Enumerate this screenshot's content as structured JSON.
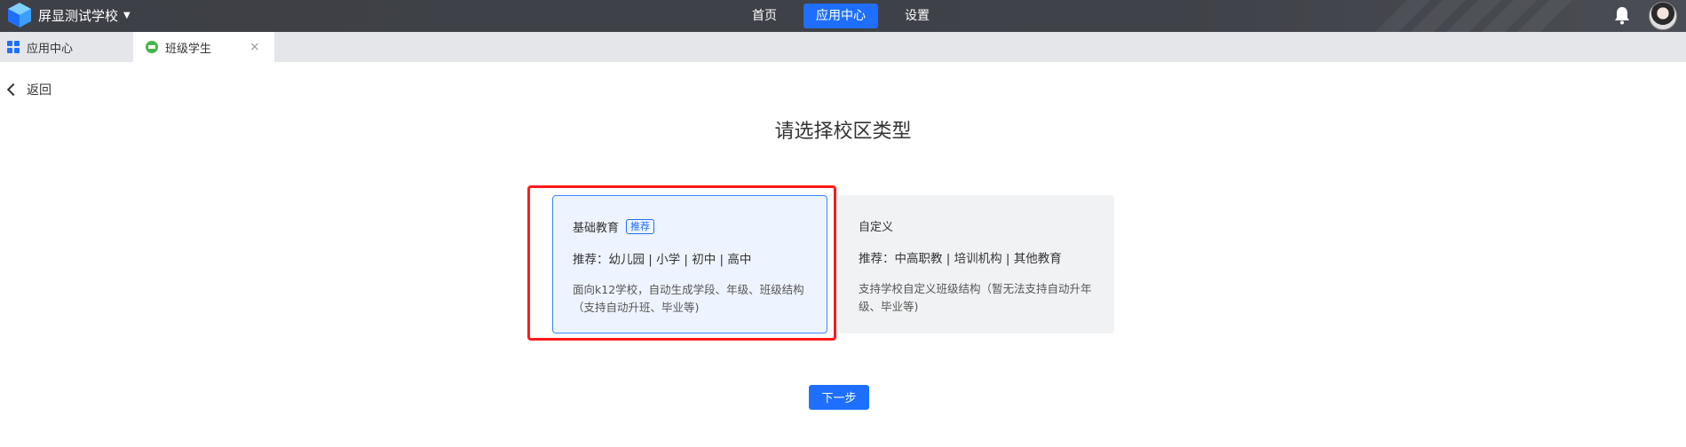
{
  "header": {
    "school_name": "屏显测试学校",
    "nav": [
      {
        "label": "首页",
        "active": false
      },
      {
        "label": "应用中心",
        "active": true
      },
      {
        "label": "设置",
        "active": false
      }
    ],
    "icons": [
      "logo-cube-icon",
      "caret-down-icon",
      "bell-icon",
      "avatar"
    ]
  },
  "tabs": [
    {
      "label": "应用中心",
      "icon": "grid-icon",
      "active": false
    },
    {
      "label": "班级学生",
      "icon": "green-class-icon",
      "active": true,
      "close": "×"
    }
  ],
  "back_label": "返回",
  "page_title": "请选择校区类型",
  "options": [
    {
      "title": "基础教育",
      "badge": "推荐",
      "recommend": "推荐：幼儿园 | 小学 | 初中 | 高中",
      "description": "面向k12学校，自动生成学段、年级、班级结构（支持自动升班、毕业等)",
      "selected": true
    },
    {
      "title": "自定义",
      "badge": "",
      "recommend": "推荐：中高职教 | 培训机构 | 其他教育",
      "description": "支持学校自定义班级结构（暂无法支持自动升年级、毕业等)",
      "selected": false
    }
  ],
  "next_button": "下一步",
  "colors": {
    "accent": "#1e6fff",
    "highlight_border": "#ff1a1a",
    "topbar": "#3f4248"
  }
}
